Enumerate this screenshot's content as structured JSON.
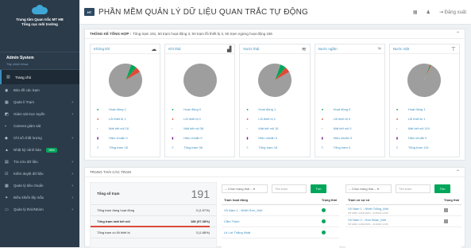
{
  "sidebar": {
    "org_line1": "Trung tâm Quan trắc MT HB",
    "org_line2": "Tổng cục môi trường",
    "user_name": "Admin System",
    "user_status": "Tây chính khoa",
    "items": [
      {
        "label": "Trang chủ",
        "icon": "home-icon",
        "glyph": "▥",
        "active": true,
        "chevron": false
      },
      {
        "label": "Bản đồ các trạm",
        "icon": "map-marker-icon",
        "glyph": "◉",
        "chevron": false
      },
      {
        "label": "Quản lí Trạm",
        "icon": "grid-icon",
        "glyph": "▦",
        "chevron": true
      },
      {
        "label": "Giám sát trực tuyến",
        "icon": "chart-icon",
        "glyph": "◩",
        "chevron": true
      },
      {
        "label": "Camera giám sát",
        "icon": "camera-icon",
        "glyph": "▪",
        "chevron": false
      },
      {
        "label": "Chỉ số chất lượng",
        "icon": "tag-icon",
        "glyph": "◆",
        "chevron": true
      },
      {
        "label": "Nhật ký cảnh báo",
        "icon": "bell-icon",
        "glyph": "▲",
        "chevron": false,
        "badge": "1894"
      },
      {
        "label": "Tra cứu dữ liệu",
        "icon": "search-doc-icon",
        "glyph": "▤",
        "chevron": true
      },
      {
        "label": "Kiểm duyệt dữ liệu",
        "icon": "check-icon",
        "glyph": "☑",
        "chevron": true
      },
      {
        "label": "Quản lý tiêu chuẩn",
        "icon": "list-icon",
        "glyph": "▦",
        "chevron": true
      },
      {
        "label": "Điều khiển lấy mẫu",
        "icon": "gear-icon",
        "glyph": "✦",
        "chevron": true
      },
      {
        "label": "Quản lý thời/Nhóm",
        "icon": "folder-icon",
        "glyph": "▭",
        "chevron": true
      }
    ]
  },
  "topbar": {
    "app_badge": "HT",
    "title": "PHẦN MỀM QUẢN LÝ DỮ LIỆU QUAN TRẮC TỰ ĐỘNG",
    "logout_label": "Đăng xuất"
  },
  "summary": {
    "heading": "THỐNG KÊ TỔNG HỢP :",
    "text": "Tổng trạm 191, 50 trạm hoạt động 3, 50 trạm lỗi thiết bị 3, 50 trạm ngừng hoạt động 186",
    "cards": [
      {
        "title": "Không khí",
        "icon": "cloud-icon",
        "glyph": "☁",
        "legend": [
          "Hoạt động 1",
          "Lỗi thiết bị 1",
          "Mất kết nối 16",
          "Hiệu chuẩn 0",
          "Tổng trạm 18"
        ],
        "pie": [
          {
            "label": "Hoạt động",
            "value": 1,
            "color": "#00a65a"
          },
          {
            "label": "Lỗi thiết bị",
            "value": 1,
            "color": "#dd4b39"
          },
          {
            "label": "Mất kết nối",
            "value": 16,
            "color": "#9e9e9e"
          }
        ]
      },
      {
        "title": "Khí thải",
        "icon": "factory-icon",
        "glyph": "▟",
        "legend": [
          "Hoạt động 0",
          "Lỗi thiết bị 0",
          "Mất kết nối 36",
          "Hiệu chuẩn 0",
          "Tổng trạm 36"
        ],
        "pie": [
          {
            "label": "Mất kết nối",
            "value": 36,
            "color": "#9e9e9e"
          }
        ]
      },
      {
        "title": "Nước thải",
        "icon": "water-drop-icon",
        "glyph": "≋",
        "legend": [
          "Hoạt động 1",
          "Lỗi thiết bị 1",
          "Mất kết nối 16",
          "Hiệu chuẩn 0",
          "Tổng trạm 18"
        ],
        "pie": [
          {
            "label": "Hoạt động",
            "value": 1,
            "color": "#00a65a"
          },
          {
            "label": "Lỗi thiết bị",
            "value": 1,
            "color": "#dd4b39"
          },
          {
            "label": "Mất kết nối",
            "value": 16,
            "color": "#9e9e9e"
          }
        ]
      },
      {
        "title": "Nước ngầm",
        "icon": "waves-icon",
        "glyph": "≈",
        "legend": [
          "Hoạt động 0",
          "Lỗi thiết bị 0",
          "Mất kết nối 0",
          "Hiệu chuẩn 0",
          "Tổng trạm 0"
        ],
        "pie": []
      },
      {
        "title": "Nước mặt",
        "icon": "faucet-icon",
        "glyph": "⊤",
        "legend": [
          "Hoạt động 1",
          "Lỗi thiết bị 1",
          "Mất kết nối 119",
          "Hiệu chuẩn 0",
          "Tổng trạm 119"
        ],
        "pie": [
          {
            "label": "Hoạt động",
            "value": 1,
            "color": "#00a65a"
          },
          {
            "label": "Lỗi thiết bị",
            "value": 1,
            "color": "#dd4b39"
          },
          {
            "label": "Mất kết nối",
            "value": 119,
            "color": "#9e9e9e"
          }
        ]
      }
    ]
  },
  "station_status": {
    "heading": "TRẠNG THÁI CÁC TRẠM",
    "total_label": "Tổng số trạm",
    "total_value": "191",
    "rows": [
      {
        "label": "Tổng trạm đang hoạt động",
        "value": "3 (1.57%)",
        "highlight": false
      },
      {
        "label": "Tổng trạm mất kết nối",
        "value": "186 (97.38%)",
        "highlight": true
      },
      {
        "label": "Tổng trạm có lỗi thiết bị",
        "value": "3 (1.88%)",
        "highlight": false
      }
    ],
    "table1": {
      "select": "-- Chọn trạng thái --",
      "input_placeholder": "Tên trạm",
      "button": "Tìm",
      "col1": "Trạm hoạt động",
      "col2": "Trạng thái",
      "rows": [
        "Võ Nam 1 - Nhiệt Sơn_Mới",
        "Cẩm Thịnh",
        "Lê Lợi Thắng Nhất"
      ]
    },
    "table2": {
      "select": "-- Chọn trạng thái --",
      "input_placeholder": "Tên trạm",
      "button": "Tìm",
      "col1": "Trạm có sự cố",
      "col2": "Trạng thái",
      "rows": [
        {
          "name": "Võ Nam 1 - Nhiệt Trắng_Mới",
          "sub": "SỐ HIỆU CẢNH BÁO - 01/2022 12:00"
        },
        {
          "name": "Võ Nam 2 - Hòa Nhạc_Mới",
          "sub": "SỐ HIỆU CẢNH BÁO - 01/2022 12:00"
        }
      ]
    }
  },
  "colors": {
    "active": "#00a65a",
    "error": "#dd4b39",
    "offline": "#9e9e9e",
    "calibrate": "#7a1f8c",
    "total": "#3c8dbc"
  }
}
